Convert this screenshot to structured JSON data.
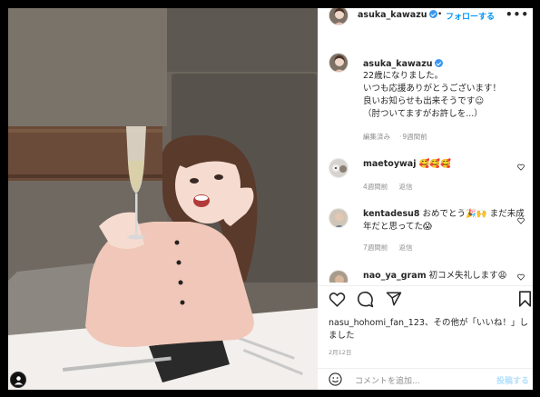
{
  "post": {
    "author": {
      "username": "asuka_kawazu",
      "verified": true,
      "follow_label": "フォローする",
      "separator": "•",
      "more_label": "•••"
    },
    "caption": {
      "lines": [
        "22歳になりました。",
        "いつも応援ありがとうございます！",
        "良いお知らせも出来そうです☺",
        "（肘ついてますがお許しを...）"
      ],
      "meta": [
        "編集済み",
        "9週間前"
      ]
    },
    "comments": [
      {
        "username": "maetoywaj",
        "text": "🥰🥰🥰",
        "meta": [
          "4週間前",
          "返信"
        ]
      },
      {
        "username": "kentadesu8",
        "text": "おめでとう🎉🙌 まだ未成年だと思ってた😱",
        "meta": [
          "7週間前",
          "返信"
        ]
      },
      {
        "username": "nao_ya_gram",
        "text": "初コメ失礼します😩",
        "meta": []
      }
    ],
    "likes_text": "nasu_hohomi_fan_123、その他が「いいね！」しました",
    "date": "2月12日",
    "comment_placeholder": "コメントを追加...",
    "post_button": "投稿する",
    "icons": [
      "heart-icon",
      "comment-icon",
      "share-icon",
      "bookmark-icon",
      "smile-icon",
      "user-tag-icon"
    ],
    "colors": {
      "accent": "#0095f6",
      "verified": "#3897f0",
      "muted": "#8e8e8e"
    }
  }
}
